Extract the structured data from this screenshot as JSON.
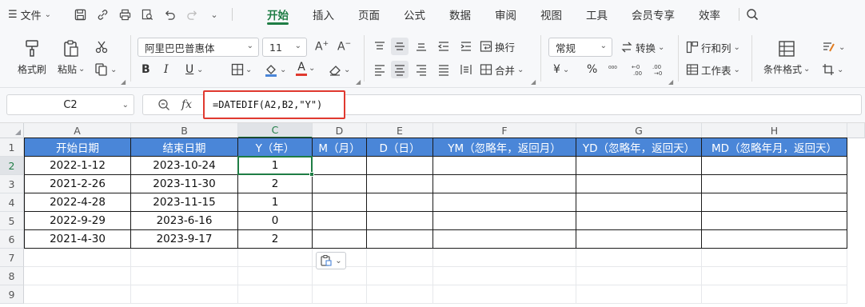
{
  "menubar": {
    "file_label": "文件",
    "tabs": [
      {
        "label": "开始",
        "active": true
      },
      {
        "label": "插入"
      },
      {
        "label": "页面"
      },
      {
        "label": "公式"
      },
      {
        "label": "数据"
      },
      {
        "label": "审阅"
      },
      {
        "label": "视图"
      },
      {
        "label": "工具"
      },
      {
        "label": "会员专享"
      },
      {
        "label": "效率"
      }
    ]
  },
  "ribbon": {
    "format_painter": "格式刷",
    "paste": "粘贴",
    "font_name": "阿里巴巴普惠体",
    "font_size": "11",
    "wrap": "换行",
    "number_format": "常规",
    "convert": "转换",
    "merge": "合并",
    "rows_cols": "行和列",
    "worksheet": "工作表",
    "conditional_format": "条件格式",
    "bold": "B",
    "italic": "I",
    "underline": "U",
    "font_color_letter": "A",
    "currency": "¥",
    "percent": "%"
  },
  "formula_bar": {
    "cell_ref": "C2",
    "fx": "fx",
    "formula": "=DATEDIF(A2,B2,\"Y\")"
  },
  "sheet": {
    "columns": [
      "A",
      "B",
      "C",
      "D",
      "E",
      "F",
      "G",
      "H"
    ],
    "rows": [
      "1",
      "2",
      "3",
      "4",
      "5",
      "6",
      "7",
      "8",
      "9"
    ],
    "header_row": [
      "开始日期",
      "结束日期",
      "Y（年）",
      "M（月）",
      "D（日）",
      "YM（忽略年，返回月）",
      "YD（忽略年，返回天）",
      "MD（忽略年月，返回天）"
    ],
    "data_rows": [
      [
        "2022-1-12",
        "2023-10-24",
        "1",
        "",
        "",
        "",
        "",
        ""
      ],
      [
        "2021-2-26",
        "2023-11-30",
        "2",
        "",
        "",
        "",
        "",
        ""
      ],
      [
        "2022-4-28",
        "2023-11-15",
        "1",
        "",
        "",
        "",
        "",
        ""
      ],
      [
        "2022-9-29",
        "2023-6-16",
        "0",
        "",
        "",
        "",
        "",
        ""
      ],
      [
        "2021-4-30",
        "2023-9-17",
        "2",
        "",
        "",
        "",
        "",
        ""
      ]
    ],
    "selected_cell": "C2"
  },
  "colors": {
    "accent": "#1f7d45",
    "header_fill": "#4a86d8",
    "highlight_border": "#e0392f"
  }
}
